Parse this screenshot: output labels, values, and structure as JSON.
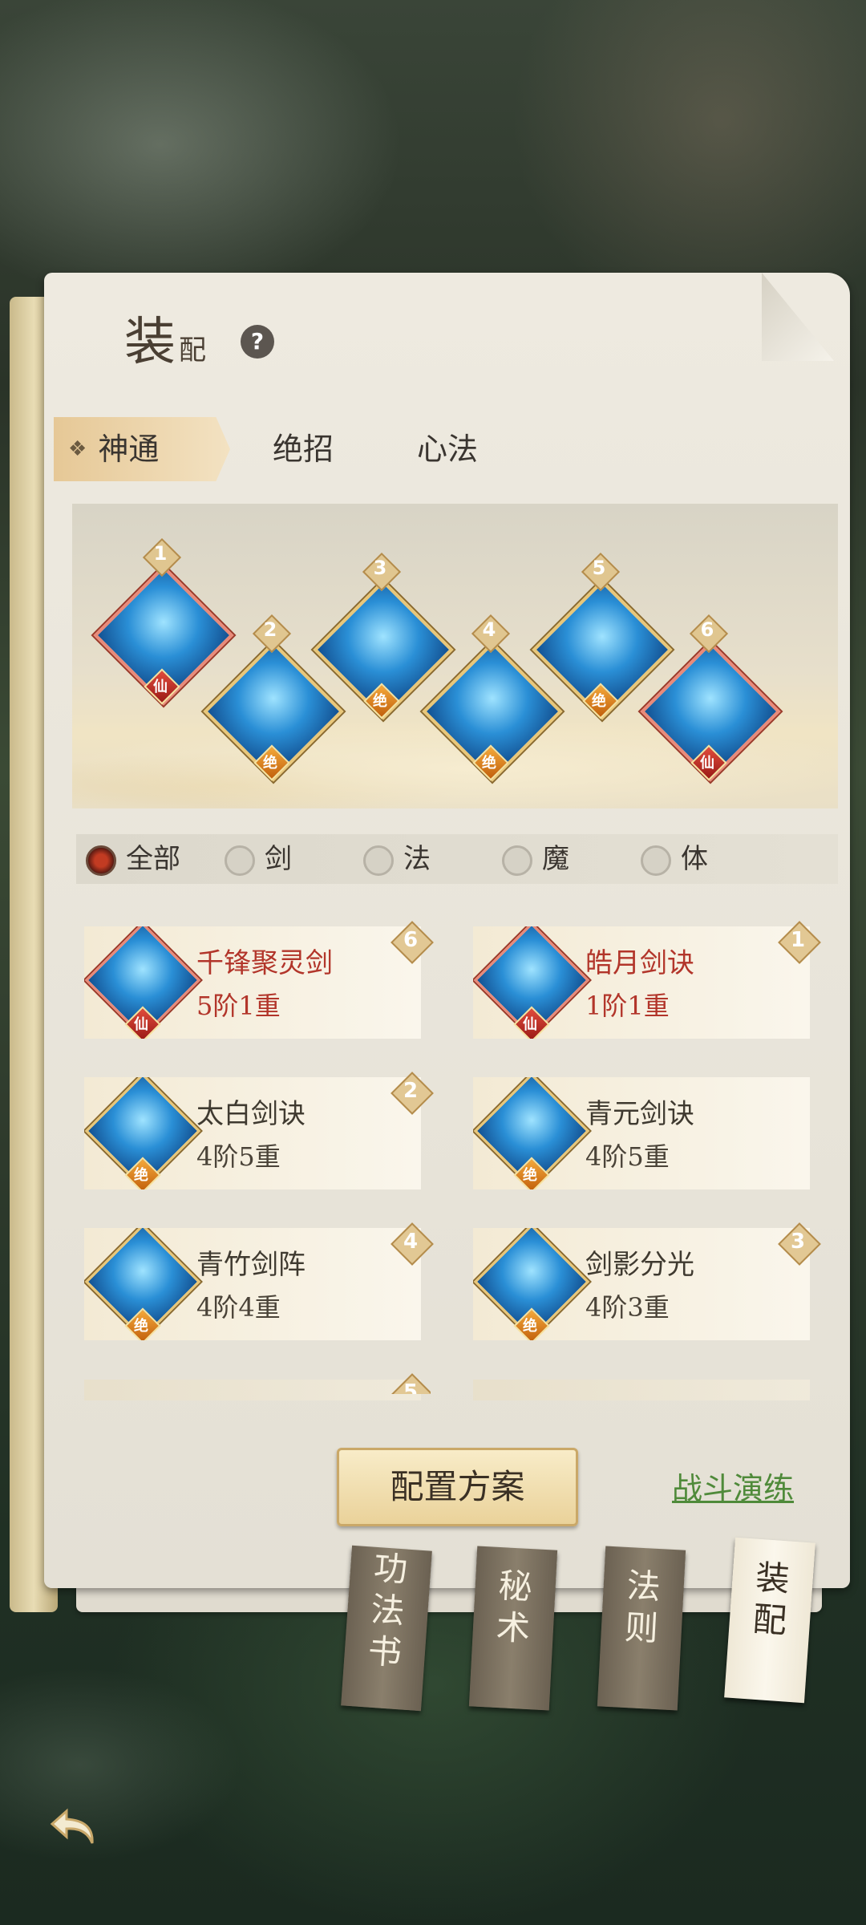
{
  "title": {
    "main": "装",
    "sub": "配",
    "help": "?"
  },
  "tabs": [
    {
      "label": "神通",
      "active": true
    },
    {
      "label": "绝招"
    },
    {
      "label": "心法"
    }
  ],
  "slots": [
    {
      "num": "1",
      "badge": "仙"
    },
    {
      "num": "2",
      "badge": "绝"
    },
    {
      "num": "3",
      "badge": "绝"
    },
    {
      "num": "4",
      "badge": "绝"
    },
    {
      "num": "5",
      "badge": "绝"
    },
    {
      "num": "6",
      "badge": "仙"
    }
  ],
  "filters": [
    {
      "label": "全部",
      "selected": true
    },
    {
      "label": "剑"
    },
    {
      "label": "法"
    },
    {
      "label": "魔"
    },
    {
      "label": "体"
    }
  ],
  "skills": [
    {
      "name": "千锋聚灵剑",
      "level": "5阶1重",
      "badge": "仙",
      "slot": "6"
    },
    {
      "name": "皓月剑诀",
      "level": "1阶1重",
      "badge": "仙",
      "slot": "1"
    },
    {
      "name": "太白剑诀",
      "level": "4阶5重",
      "badge": "绝",
      "slot": "2"
    },
    {
      "name": "青元剑诀",
      "level": "4阶5重",
      "badge": "绝",
      "slot": ""
    },
    {
      "name": "青竹剑阵",
      "level": "4阶4重",
      "badge": "绝",
      "slot": "4"
    },
    {
      "name": "剑影分光",
      "level": "4阶3重",
      "badge": "绝",
      "slot": "3"
    }
  ],
  "partial_slot": "5",
  "buttons": {
    "plan": "配置方案",
    "battle": "战斗演练"
  },
  "book_tabs": [
    {
      "chars": [
        "功",
        "法",
        "书"
      ]
    },
    {
      "chars": [
        "秘",
        "术"
      ]
    },
    {
      "chars": [
        "法",
        "则"
      ]
    },
    {
      "chars": [
        "装",
        "配"
      ],
      "active": true
    }
  ],
  "colors": {
    "xian": "#b2352a",
    "jue": "#f4a93b",
    "battle": "#4f8a3a"
  }
}
